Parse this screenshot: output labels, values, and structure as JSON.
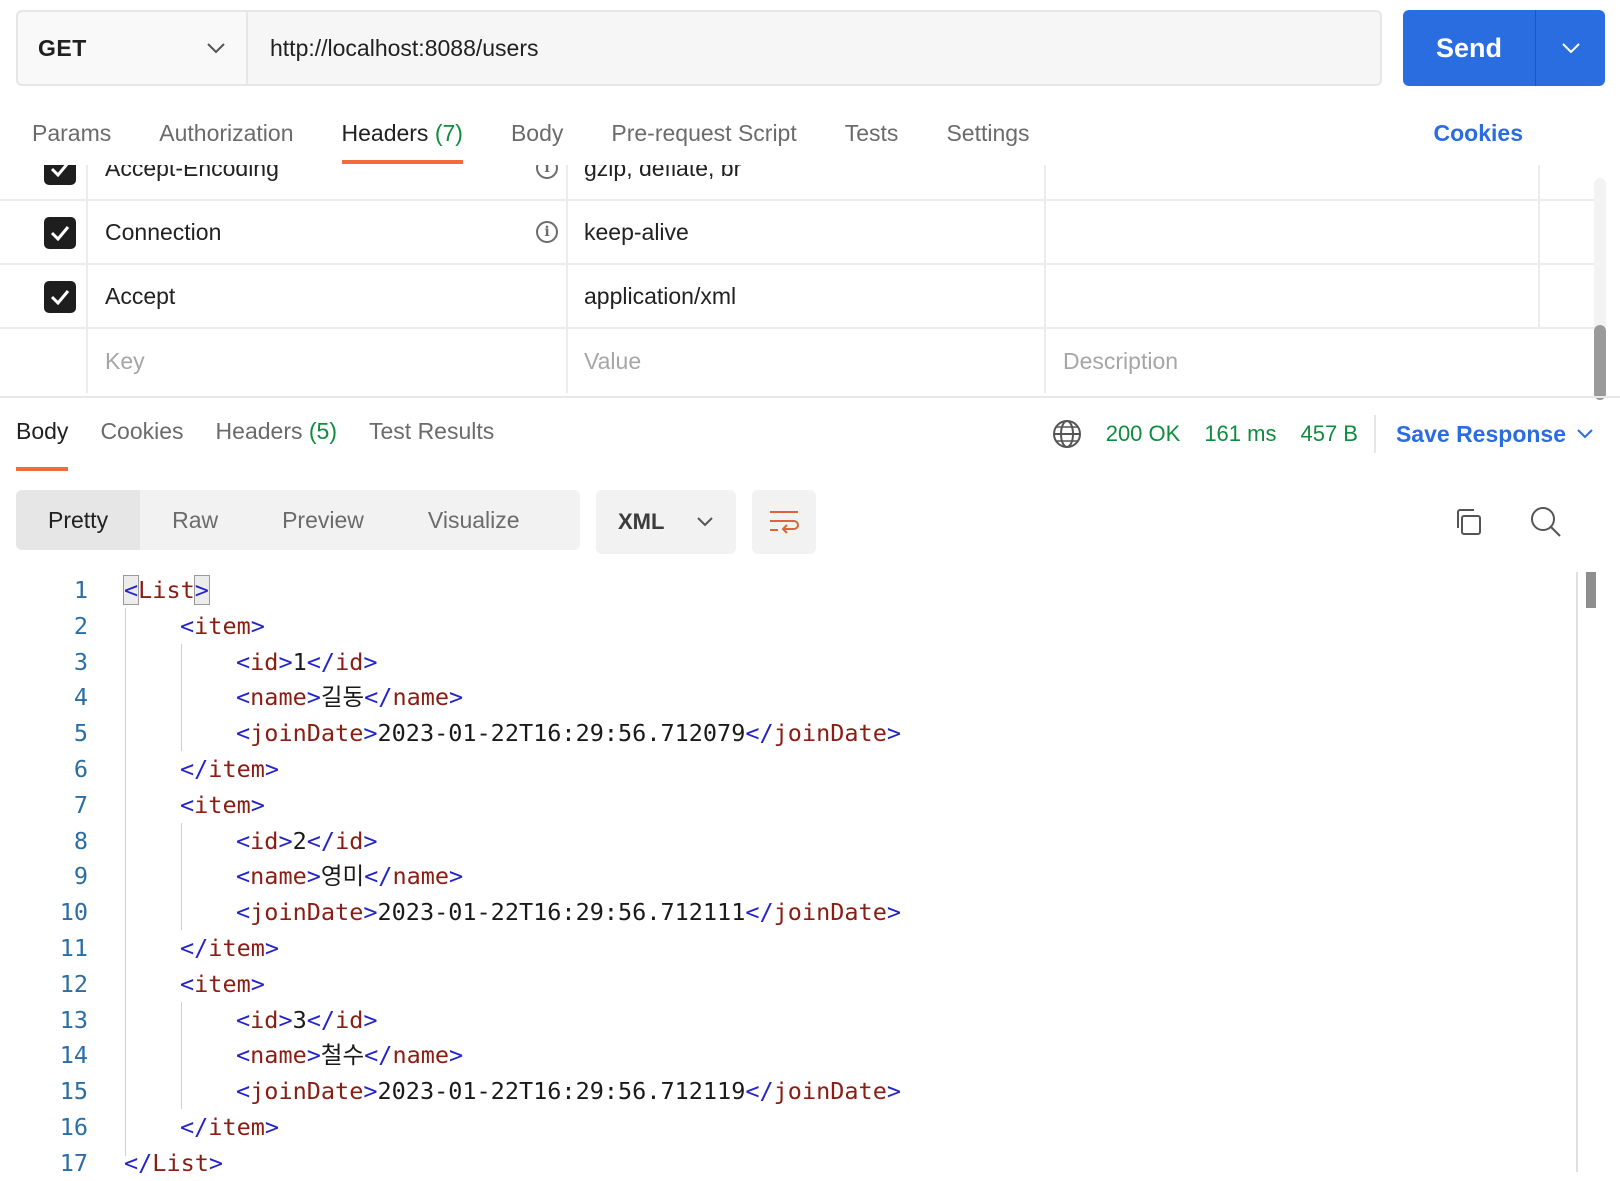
{
  "request": {
    "method": "GET",
    "url": "http://localhost:8088/users",
    "send_label": "Send"
  },
  "request_tabs": [
    {
      "label": "Params"
    },
    {
      "label": "Authorization"
    },
    {
      "label": "Headers",
      "count": "(7)"
    },
    {
      "label": "Body"
    },
    {
      "label": "Pre-request Script"
    },
    {
      "label": "Tests"
    },
    {
      "label": "Settings"
    }
  ],
  "cookies_link": "Cookies",
  "headers_table": {
    "rows": [
      {
        "key": "Accept-Encoding",
        "value": "gzip, deflate, br",
        "checked": true,
        "info": true
      },
      {
        "key": "Connection",
        "value": "keep-alive",
        "checked": true,
        "info": true
      },
      {
        "key": "Accept",
        "value": "application/xml",
        "checked": true,
        "info": false
      }
    ],
    "placeholders": {
      "key": "Key",
      "value": "Value",
      "description": "Description"
    }
  },
  "response_tabs": [
    {
      "label": "Body"
    },
    {
      "label": "Cookies"
    },
    {
      "label": "Headers",
      "count": "(5)"
    },
    {
      "label": "Test Results"
    }
  ],
  "response_status": {
    "status": "200 OK",
    "time": "161 ms",
    "size": "457 B",
    "save_label": "Save Response"
  },
  "view_modes": [
    "Pretty",
    "Raw",
    "Preview",
    "Visualize"
  ],
  "format": "XML",
  "code_lines": [
    {
      "n": "1",
      "indent": 0,
      "open": "List",
      "content": null,
      "close": null
    },
    {
      "n": "2",
      "indent": 1,
      "open": "item",
      "content": null,
      "close": null
    },
    {
      "n": "3",
      "indent": 2,
      "open": "id",
      "content": "1",
      "close": "id"
    },
    {
      "n": "4",
      "indent": 2,
      "open": "name",
      "content": "길동",
      "close": "name"
    },
    {
      "n": "5",
      "indent": 2,
      "open": "joinDate",
      "content": "2023-01-22T16:29:56.712079",
      "close": "joinDate"
    },
    {
      "n": "6",
      "indent": 1,
      "open": null,
      "content": null,
      "close": "item"
    },
    {
      "n": "7",
      "indent": 1,
      "open": "item",
      "content": null,
      "close": null
    },
    {
      "n": "8",
      "indent": 2,
      "open": "id",
      "content": "2",
      "close": "id"
    },
    {
      "n": "9",
      "indent": 2,
      "open": "name",
      "content": "영미",
      "close": "name"
    },
    {
      "n": "10",
      "indent": 2,
      "open": "joinDate",
      "content": "2023-01-22T16:29:56.712111",
      "close": "joinDate"
    },
    {
      "n": "11",
      "indent": 1,
      "open": null,
      "content": null,
      "close": "item"
    },
    {
      "n": "12",
      "indent": 1,
      "open": "item",
      "content": null,
      "close": null
    },
    {
      "n": "13",
      "indent": 2,
      "open": "id",
      "content": "3",
      "close": "id"
    },
    {
      "n": "14",
      "indent": 2,
      "open": "name",
      "content": "철수",
      "close": "name"
    },
    {
      "n": "15",
      "indent": 2,
      "open": "joinDate",
      "content": "2023-01-22T16:29:56.712119",
      "close": "joinDate"
    },
    {
      "n": "16",
      "indent": 1,
      "open": null,
      "content": null,
      "close": "item"
    },
    {
      "n": "17",
      "indent": 0,
      "open": null,
      "content": null,
      "close": "List"
    }
  ],
  "colors": {
    "accent": "#2a6de1",
    "tab_indicator": "#f26b3a",
    "status_green": "#0f8c3e",
    "xml_tag": "#8a1d14",
    "xml_bracket": "#2323c8",
    "line_number": "#2b6ea6"
  }
}
